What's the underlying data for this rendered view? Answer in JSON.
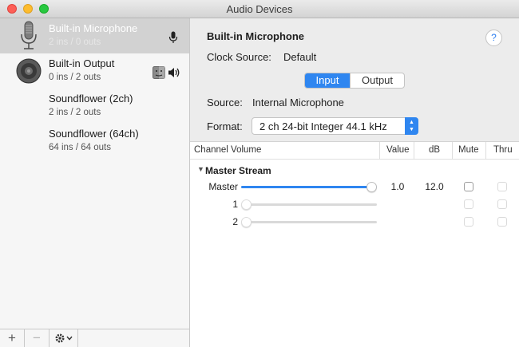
{
  "window": {
    "title": "Audio Devices"
  },
  "sidebar": {
    "devices": [
      {
        "name": "Built-in Microphone",
        "io": "2 ins / 0 outs",
        "icon": "microphone-icon",
        "side_icon": "input-microphone-icon"
      },
      {
        "name": "Built-in Output",
        "io": "0 ins / 2 outs",
        "icon": "speaker-icon",
        "side_icon": "finder-speaker-icon"
      },
      {
        "name": "Soundflower (2ch)",
        "io": "2 ins / 2 outs"
      },
      {
        "name": "Soundflower (64ch)",
        "io": "64 ins / 64 outs"
      }
    ],
    "selected_index": 0,
    "bottom": {
      "add": "+",
      "remove": "−"
    }
  },
  "main": {
    "device_title": "Built-in Microphone",
    "help": "?",
    "clock_source_label": "Clock Source:",
    "clock_source_value": "Default",
    "tabs": [
      {
        "label": "Input",
        "active": true
      },
      {
        "label": "Output",
        "active": false
      }
    ],
    "source_label": "Source:",
    "source_value": "Internal Microphone",
    "format_label": "Format:",
    "format_value": "2 ch 24-bit Integer 44.1 kHz"
  },
  "table": {
    "columns": {
      "channel": "Channel Volume",
      "value": "Value",
      "db": "dB",
      "mute": "Mute",
      "thru": "Thru"
    },
    "stream": "Master Stream",
    "rows": [
      {
        "label": "Master",
        "value": "1.0",
        "db": "12.0",
        "level": 1.0,
        "enabled": true
      },
      {
        "label": "1",
        "value": "",
        "db": "",
        "level": 0.0,
        "enabled": false
      },
      {
        "label": "2",
        "value": "",
        "db": "",
        "level": 0.0,
        "enabled": false
      }
    ]
  },
  "colors": {
    "accent": "#2f86f0",
    "selection": "#d2d2d2"
  }
}
